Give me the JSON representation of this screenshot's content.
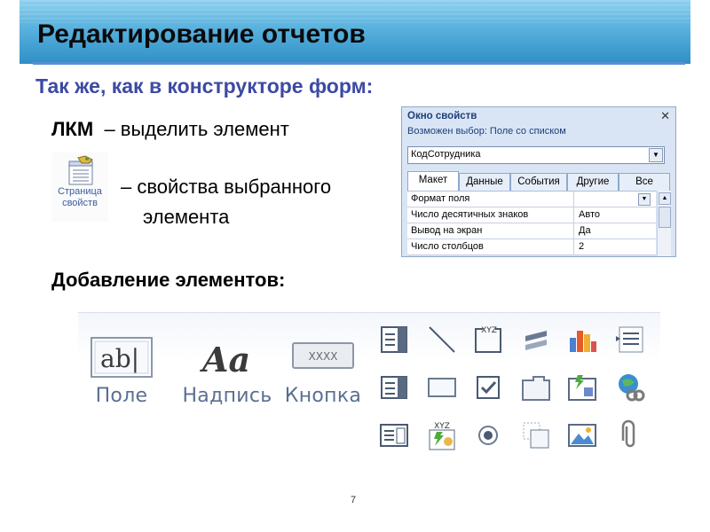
{
  "slide": {
    "title": "Редактирование отчетов",
    "subtitle": "Так же, как в конструкторе форм:",
    "lkm_key": "ЛКМ",
    "lkm_action": "– выделить  элемент",
    "props_icon_label_line1": "Страница",
    "props_icon_label_line2": "свойств",
    "props_text_line1": "– свойства выбранного",
    "props_text_line2": "элемента",
    "add_title": "Добавление элементов:",
    "page_number": "7"
  },
  "property_sheet": {
    "header": "Окно свойств",
    "close_glyph": "✕",
    "selection_type": "Возможен выбор:  Поле со списком",
    "selected_object": "КодСотрудника",
    "tabs": [
      "Макет",
      "Данные",
      "События",
      "Другие",
      "Все"
    ],
    "active_tab": "Макет",
    "rows": [
      {
        "key": "Формат поля",
        "value": ""
      },
      {
        "key": "Число десятичных знаков",
        "value": "Авто"
      },
      {
        "key": "Вывод на экран",
        "value": "Да"
      },
      {
        "key": "Число столбцов",
        "value": "2"
      }
    ]
  },
  "controls": {
    "textbox_icon_text": "ab|",
    "textbox_label": "Поле",
    "label_icon_text": "Aa",
    "label_label": "Надпись",
    "button_icon_text": "XXXX",
    "button_label": "Кнопка",
    "icons": [
      "combo-box-icon",
      "line-icon",
      "group-box-icon",
      "toggle-icon",
      "chart-icon",
      "list-icon",
      "combo-icon-2",
      "rectangle-icon",
      "checkbox-icon",
      "tab-control-icon",
      "image-icon",
      "hyperlink-icon",
      "list-box-icon",
      "option-group-icon",
      "radio-icon",
      "subform-icon",
      "picture-icon",
      "attachment-icon"
    ]
  },
  "colors": {
    "header_top": "#8fd0ef",
    "header_bottom": "#2f8fc6",
    "subtitle": "#3d4aa3",
    "rule": "#5a8fd8"
  }
}
